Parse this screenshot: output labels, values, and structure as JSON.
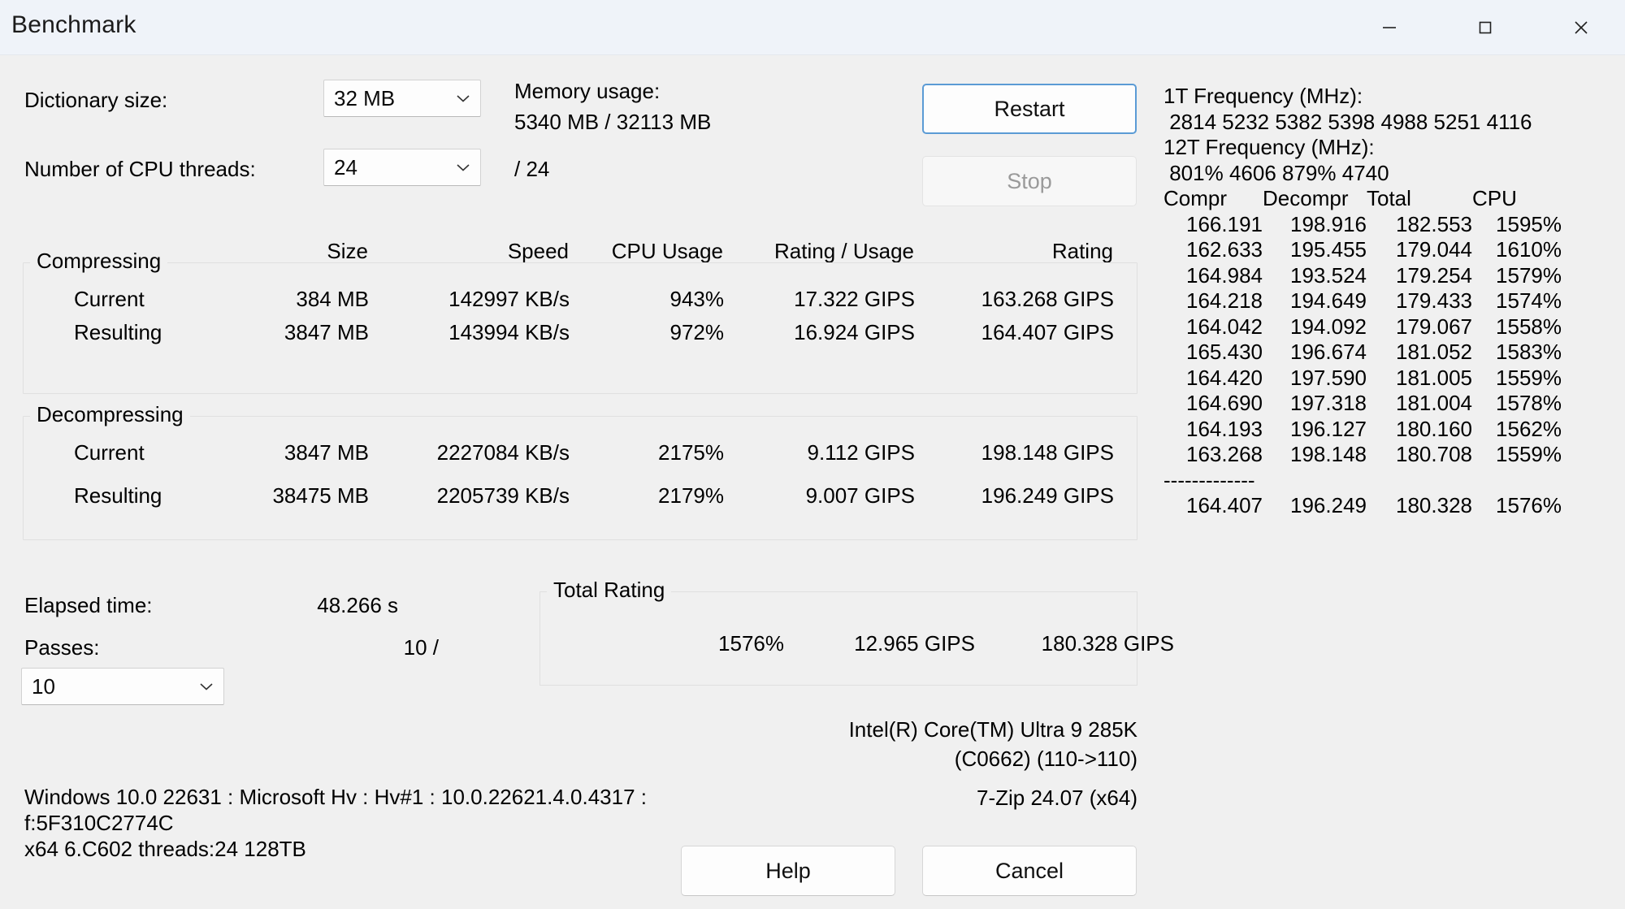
{
  "window": {
    "title": "Benchmark",
    "controls": [
      {
        "name": "minimize-button",
        "glyph": "minimize-icon"
      },
      {
        "name": "maximize-button",
        "glyph": "maximize-icon"
      },
      {
        "name": "close-button",
        "glyph": "close-icon"
      }
    ]
  },
  "settings": {
    "dictionary_label": "Dictionary size:",
    "dictionary_value": "32 MB",
    "threads_label": "Number of CPU threads:",
    "threads_value": "24",
    "threads_max": "/ 24",
    "memory_label": "Memory usage:",
    "memory_value": "5340 MB / 32113 MB"
  },
  "actions": {
    "restart": "Restart",
    "stop": "Stop",
    "help": "Help",
    "cancel": "Cancel"
  },
  "results": {
    "columns": [
      "Size",
      "Speed",
      "CPU Usage",
      "Rating / Usage",
      "Rating"
    ],
    "compressing": {
      "legend": "Compressing",
      "rows": [
        {
          "label": "Current",
          "size": "384 MB",
          "speed": "142997 KB/s",
          "cpu": "943%",
          "rating_usage": "17.322 GIPS",
          "rating": "163.268 GIPS"
        },
        {
          "label": "Resulting",
          "size": "3847 MB",
          "speed": "143994 KB/s",
          "cpu": "972%",
          "rating_usage": "16.924 GIPS",
          "rating": "164.407 GIPS"
        }
      ]
    },
    "decompressing": {
      "legend": "Decompressing",
      "rows": [
        {
          "label": "Current",
          "size": "3847 MB",
          "speed": "2227084 KB/s",
          "cpu": "2175%",
          "rating_usage": "9.112 GIPS",
          "rating": "198.148 GIPS"
        },
        {
          "label": "Resulting",
          "size": "38475 MB",
          "speed": "2205739 KB/s",
          "cpu": "2179%",
          "rating_usage": "9.007 GIPS",
          "rating": "196.249 GIPS"
        }
      ]
    }
  },
  "progress": {
    "elapsed_label": "Elapsed time:",
    "elapsed_value": "48.266 s",
    "passes_label": "Passes:",
    "passes_value": "10 /",
    "passes_selected": "10"
  },
  "total_rating": {
    "legend": "Total Rating",
    "cpu": "1576%",
    "rating_usage": "12.965 GIPS",
    "rating": "180.328 GIPS"
  },
  "cpu_info": {
    "name_line1": "Intel(R) Core(TM) Ultra 9 285K",
    "name_line2": "(C0662) (110->110)",
    "zip_version": "7-Zip 24.07 (x64)",
    "system": "Windows 10.0 22631 : Microsoft Hv : Hv#1 : 10.0.22621.4.0.4317 :\nf:5F310C2774C\nx64 6.C602 threads:24 128TB"
  },
  "frequency_panel": {
    "t1_label": "1T Frequency (MHz):",
    "t1_values": " 2814 5232 5382 5398 4988 5251 4116",
    "t12_label": "12T Frequency (MHz):",
    "t12_values": " 801% 4606 879% 4740",
    "log_header": [
      "Compr",
      "Decompr",
      "Total",
      "  CPU"
    ],
    "log_rows": [
      [
        "166.191",
        "198.916",
        "182.553",
        "1595%"
      ],
      [
        "162.633",
        "195.455",
        "179.044",
        "1610%"
      ],
      [
        "164.984",
        "193.524",
        "179.254",
        "1579%"
      ],
      [
        "164.218",
        "194.649",
        "179.433",
        "1574%"
      ],
      [
        "164.042",
        "194.092",
        "179.067",
        "1558%"
      ],
      [
        "165.430",
        "196.674",
        "181.052",
        "1583%"
      ],
      [
        "164.420",
        "197.590",
        "181.005",
        "1559%"
      ],
      [
        "164.690",
        "197.318",
        "181.004",
        "1578%"
      ],
      [
        "164.193",
        "196.127",
        "180.160",
        "1562%"
      ],
      [
        "163.268",
        "198.148",
        "180.708",
        "1559%"
      ]
    ],
    "divider": "-------------",
    "summary_row": [
      "164.407",
      "196.249",
      "180.328",
      "1576%"
    ]
  },
  "colors": {
    "window_bg": "#f0f0f0",
    "titlebar_bg": "#eff3f9",
    "accent": "#5b9bd5",
    "disabled_text": "#9a9a9a"
  }
}
